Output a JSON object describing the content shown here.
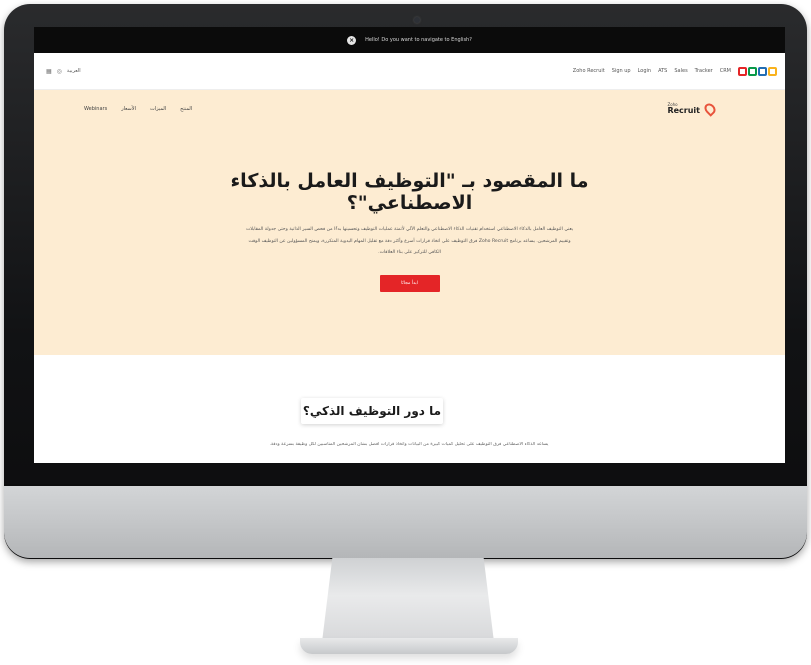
{
  "notice": {
    "text": "Hello! Do you want to navigate to English?"
  },
  "topbar": {
    "right_links": [
      "CRM",
      "Tracker",
      "Sales",
      "ATS",
      "Login",
      "Sign up",
      "Zoho Recruit"
    ],
    "left_label": "العربية"
  },
  "brand": {
    "small": "Zoho",
    "big": "Recruit"
  },
  "subnav": {
    "links": [
      "المنتج",
      "الميزات",
      "الأسعار",
      "Webinars"
    ]
  },
  "hero": {
    "title": "ما المقصود بـ \"التوظيف العامل بالذكاء الاصطناعي\"؟",
    "paragraph": "يعني التوظيف العامل بالذكاء الاصطناعي استخدام تقنيات الذكاء الاصطناعي والتعلم الآلي لأتمتة عمليات التوظيف وتحسينها بدءًا من فحص السير الذاتية وحتى جدولة المقابلات وتقييم المرشحين. يساعد برنامج Zoho Recruit فرق التوظيف على اتخاذ قرارات أسرع وأكثر دقة مع تقليل المهام اليدوية المتكررة، ويمنح المسؤولين عن التوظيف الوقت الكافي للتركيز على بناء العلاقات.",
    "cta_label": "ابدأ مجانًا"
  },
  "section": {
    "title": "ما دور التوظيف الذكي؟",
    "paragraph": "يساعد الذكاء الاصطناعي فرق التوظيف على تحليل كميات كبيرة من البيانات واتخاذ قرارات أفضل بشأن المرشحين المناسبين لكل وظيفة بسرعة ودقة."
  },
  "colors": {
    "hero_bg": "#fdecd2",
    "cta": "#e42527",
    "logo": [
      "#e42527",
      "#089949",
      "#226db4",
      "#f9b21d"
    ]
  }
}
